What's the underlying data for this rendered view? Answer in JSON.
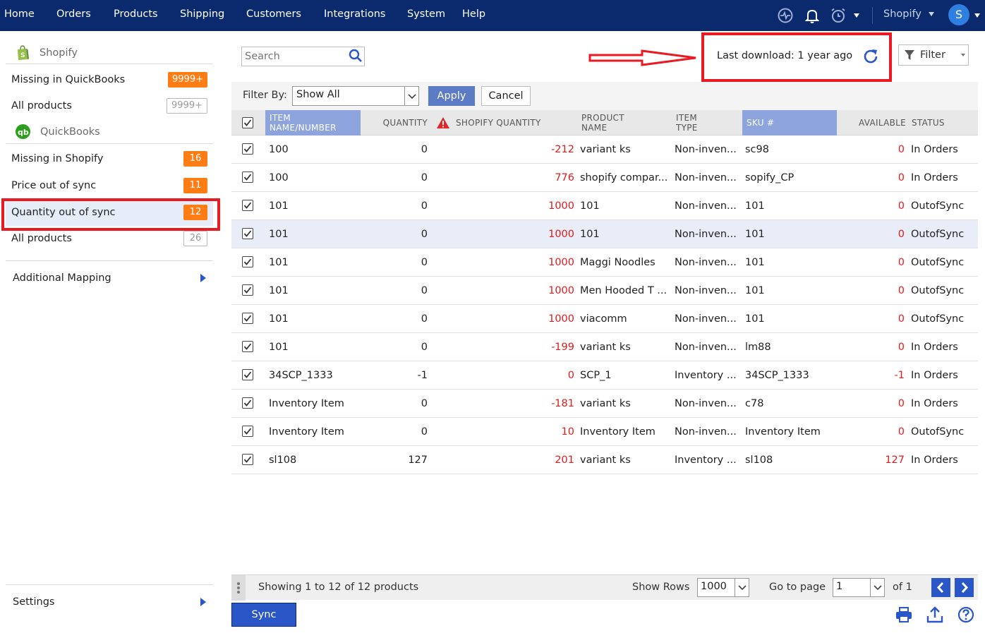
{
  "nav": {
    "items": [
      "Home",
      "Orders",
      "Products",
      "Shipping",
      "Customers",
      "Integrations",
      "System",
      "Help"
    ],
    "store": "Shopify",
    "avatar": "S",
    "icons": [
      "activity-icon",
      "bell-icon",
      "alarm-clock-icon"
    ]
  },
  "sidebar": {
    "shopify_heading": "Shopify",
    "quickbooks_heading": "QuickBooks",
    "shopify_items": [
      {
        "label": "Missing in QuickBooks",
        "badge": "9999+"
      },
      {
        "label": "All products",
        "badge": "9999+"
      }
    ],
    "quickbooks_items": [
      {
        "label": "Missing in Shopify",
        "badge": "16"
      },
      {
        "label": "Price out of sync",
        "badge": "11"
      },
      {
        "label": "Quantity out of sync",
        "badge": "12"
      },
      {
        "label": "All products",
        "badge": "26"
      }
    ],
    "additional_mapping": "Additional Mapping",
    "settings": "Settings"
  },
  "toolbar": {
    "search_placeholder": "Search",
    "last_download": "Last download: 1 year ago",
    "filter_label": "Filter"
  },
  "filterbar": {
    "label": "Filter By:",
    "selected": "Show All",
    "apply": "Apply",
    "cancel": "Cancel"
  },
  "table": {
    "columns": [
      "ITEM NAME/NUMBER",
      "QUANTITY",
      "SHOPIFY QUANTITY",
      "PRODUCT NAME",
      "ITEM TYPE",
      "SKU #",
      "AVAILABLE",
      "STATUS"
    ],
    "rows": [
      {
        "item": "100",
        "qty": "0",
        "shopify_qty": "-212",
        "product": "variant ks",
        "type": "Non-inven...",
        "sku": "sc98",
        "available": "0",
        "status": "In Orders"
      },
      {
        "item": "100",
        "qty": "0",
        "shopify_qty": "776",
        "product": "shopify compar...",
        "type": "Non-inven...",
        "sku": "sopify_CP",
        "available": "0",
        "status": "In Orders"
      },
      {
        "item": "101",
        "qty": "0",
        "shopify_qty": "1000",
        "product": "101",
        "type": "Non-inven...",
        "sku": "101",
        "available": "0",
        "status": "OutofSync"
      },
      {
        "item": "101",
        "qty": "0",
        "shopify_qty": "1000",
        "product": "101",
        "type": "Non-inven...",
        "sku": "101",
        "available": "0",
        "status": "OutofSync"
      },
      {
        "item": "101",
        "qty": "0",
        "shopify_qty": "1000",
        "product": "Maggi Noodles",
        "type": "Non-inven...",
        "sku": "101",
        "available": "0",
        "status": "OutofSync"
      },
      {
        "item": "101",
        "qty": "0",
        "shopify_qty": "1000",
        "product": "Men Hooded T ...",
        "type": "Non-inven...",
        "sku": "101",
        "available": "0",
        "status": "OutofSync"
      },
      {
        "item": "101",
        "qty": "0",
        "shopify_qty": "1000",
        "product": "viacomm",
        "type": "Non-inven...",
        "sku": "101",
        "available": "0",
        "status": "OutofSync"
      },
      {
        "item": "101",
        "qty": "0",
        "shopify_qty": "-199",
        "product": "variant ks",
        "type": "Non-inven...",
        "sku": "lm88",
        "available": "0",
        "status": "In Orders"
      },
      {
        "item": "34SCP_1333",
        "qty": "-1",
        "shopify_qty": "0",
        "product": "SCP_1",
        "type": "Inventory ...",
        "sku": "34SCP_1333",
        "available": "-1",
        "status": "In Orders"
      },
      {
        "item": "Inventory Item",
        "qty": "0",
        "shopify_qty": "-181",
        "product": "variant ks",
        "type": "Non-inven...",
        "sku": "c78",
        "available": "0",
        "status": "In Orders"
      },
      {
        "item": "Inventory Item",
        "qty": "0",
        "shopify_qty": "10",
        "product": "Inventory Item",
        "type": "Non-inven...",
        "sku": "Inventory Item",
        "available": "0",
        "status": "OutofSync"
      },
      {
        "item": "sl108",
        "qty": "127",
        "shopify_qty": "201",
        "product": "variant ks",
        "type": "Inventory ...",
        "sku": "sl108",
        "available": "127",
        "status": "In Orders"
      }
    ]
  },
  "footer": {
    "showing": "Showing 1 to 12 of 12 products",
    "show_rows_label": "Show Rows",
    "show_rows_value": "1000",
    "go_to_page_label": "Go to page",
    "page_value": "1",
    "of_label": "of 1",
    "sync": "Sync"
  },
  "colors": {
    "nav_bg": "#0b2a6e",
    "accent": "#2b56c7",
    "badge_orange": "#ff7d14",
    "negative_red": "#e21b1b",
    "highlight_red": "#e81b23"
  }
}
